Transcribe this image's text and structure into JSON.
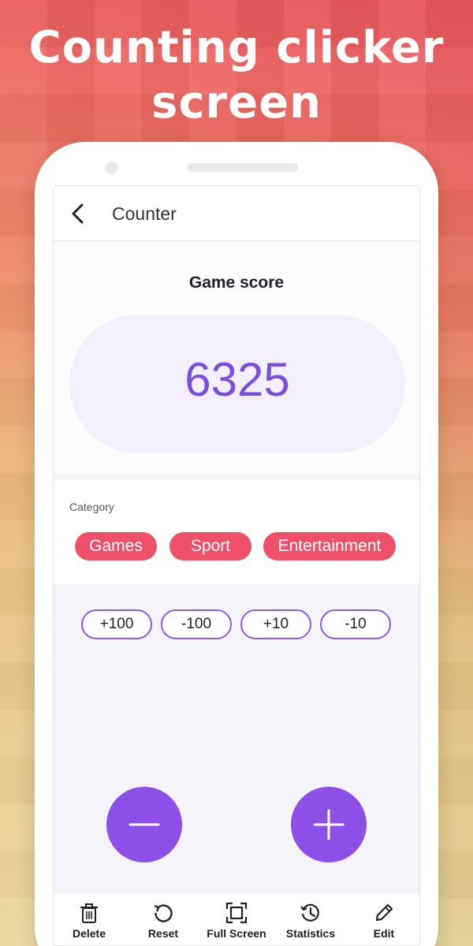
{
  "promo": {
    "headline_line1": "Counting clicker",
    "headline_line2": "screen"
  },
  "appbar": {
    "back_icon": "arrow-back-icon",
    "title": "Counter"
  },
  "counter": {
    "label": "Game score",
    "value": "6325"
  },
  "category": {
    "label": "Category",
    "chips": [
      "Games",
      "Sport",
      "Entertainment"
    ]
  },
  "steps": [
    "+100",
    "-100",
    "+10",
    "-10"
  ],
  "actions": {
    "decrement_icon": "minus-icon",
    "increment_icon": "plus-icon"
  },
  "bottom_bar": [
    {
      "label": "Delete",
      "icon": "trash-icon"
    },
    {
      "label": "Reset",
      "icon": "reset-icon"
    },
    {
      "label": "Full Screen",
      "icon": "fullscreen-icon"
    },
    {
      "label": "Statistics",
      "icon": "history-icon"
    },
    {
      "label": "Edit",
      "icon": "pencil-icon"
    }
  ],
  "colors": {
    "accent_purple": "#8c50e8",
    "score_text": "#7a4fe0",
    "chip_red": "#ee5069",
    "pill_bg": "#f3effd"
  }
}
